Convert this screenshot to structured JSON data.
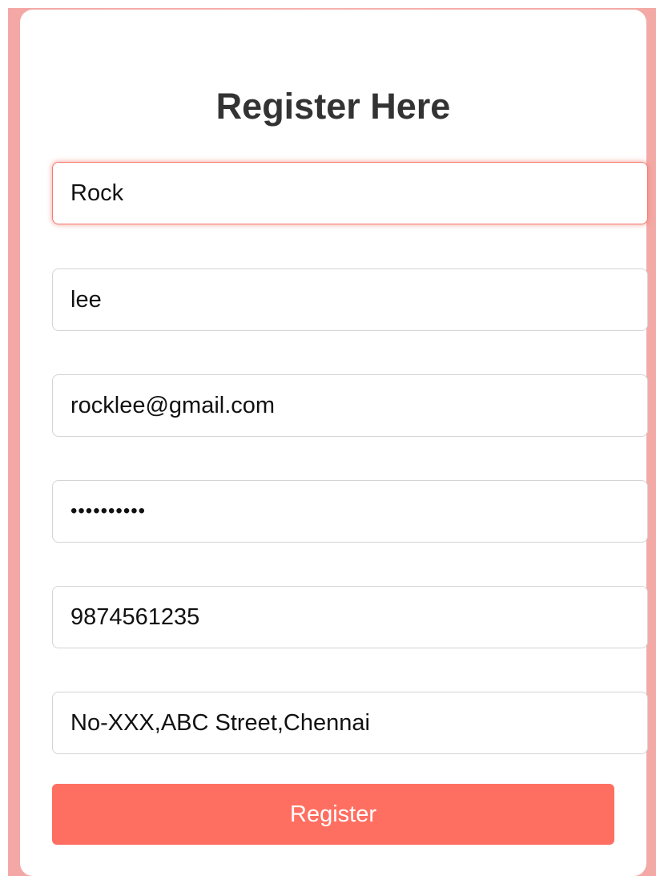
{
  "form": {
    "title": "Register Here",
    "fields": [
      {
        "value": "Rock"
      },
      {
        "value": "lee"
      },
      {
        "value": "rocklee@gmail.com"
      },
      {
        "value": "••••••••••"
      },
      {
        "value": "9874561235"
      },
      {
        "value": "No-XXX,ABC Street,Chennai"
      }
    ],
    "submit_label": "Register"
  },
  "colors": {
    "accent": "#ff6f61",
    "background": "#f4a8a6",
    "card": "#ffffff",
    "title_text": "#333333"
  }
}
